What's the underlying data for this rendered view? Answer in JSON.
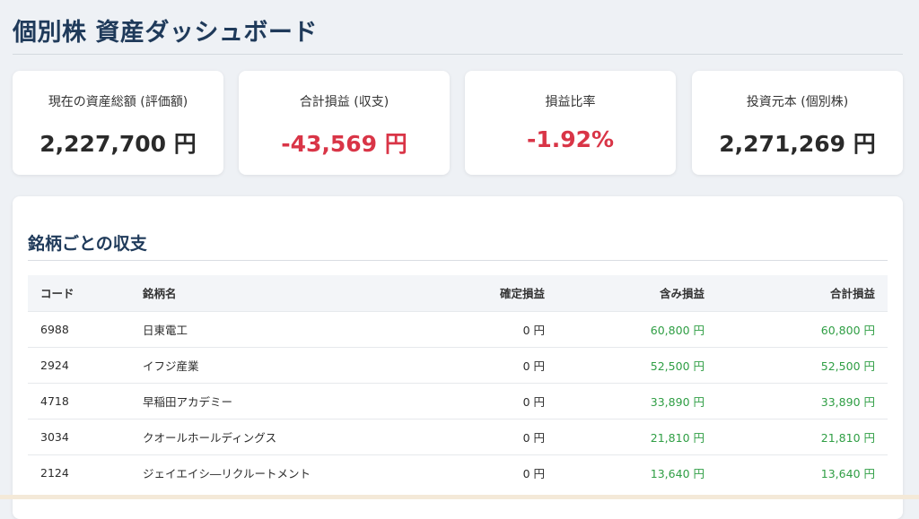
{
  "header": {
    "title": "個別株 資産ダッシュボード"
  },
  "cards": [
    {
      "label": "現在の資産総額 (評価額)",
      "value": "2,227,700 円",
      "negative": false
    },
    {
      "label": "合計損益 (収支)",
      "value": "-43,569 円",
      "negative": true
    },
    {
      "label": "損益比率",
      "value": "-1.92%",
      "negative": true
    },
    {
      "label": "投資元本 (個別株)",
      "value": "2,271,269 円",
      "negative": false
    }
  ],
  "panel": {
    "title": "銘柄ごとの収支"
  },
  "table": {
    "headers": [
      "コード",
      "銘柄名",
      "確定損益",
      "含み損益",
      "合計損益"
    ],
    "rows": [
      [
        "6988",
        "日東電工",
        "0 円",
        "60,800 円",
        "60,800 円"
      ],
      [
        "2924",
        "イフジ産業",
        "0 円",
        "52,500 円",
        "52,500 円"
      ],
      [
        "4718",
        "早稲田アカデミー",
        "0 円",
        "33,890 円",
        "33,890 円"
      ],
      [
        "3034",
        "クオールホールディングス",
        "0 円",
        "21,810 円",
        "21,810 円"
      ],
      [
        "2124",
        "ジェイエイシ―リクルートメント",
        "0 円",
        "13,640 円",
        "13,640 円"
      ]
    ]
  },
  "colors": {
    "negative": "#d93547",
    "positive": "#2f9e44",
    "heading": "#1f3a5a"
  }
}
